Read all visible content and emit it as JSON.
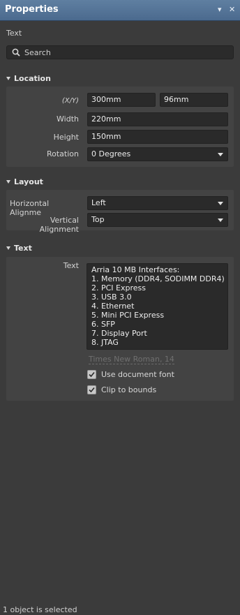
{
  "window": {
    "title": "Properties",
    "menu_icon": "▾",
    "close_icon": "✕"
  },
  "selection_type": "Text",
  "search": {
    "placeholder": "Search"
  },
  "location": {
    "header": "Location",
    "xy_label": "(X/Y)",
    "x_value": "300mm",
    "y_value": "96mm",
    "width_label": "Width",
    "width_value": "220mm",
    "height_label": "Height",
    "height_value": "150mm",
    "rotation_label": "Rotation",
    "rotation_value": "0 Degrees"
  },
  "layout": {
    "header": "Layout",
    "h_align_label": "Horizontal Alignme",
    "h_align_value": "Left",
    "v_align_label": "Vertical Alignment",
    "v_align_value": "Top"
  },
  "text": {
    "header": "Text",
    "text_label": "Text",
    "lines": [
      "Arria 10 MB Interfaces:",
      "1. Memory (DDR4, SODIMM DDR4)",
      "2. PCI Express",
      "3. USB 3.0",
      "4. Ethernet",
      "5. Mini PCI Express",
      "6. SFP",
      "7. Display Port",
      "8. JTAG"
    ],
    "font": "Times New Roman, 14",
    "use_document_font_label": "Use document font",
    "use_document_font_checked": true,
    "clip_to_bounds_label": "Clip to bounds",
    "clip_to_bounds_checked": true
  },
  "status": "1 object is selected"
}
